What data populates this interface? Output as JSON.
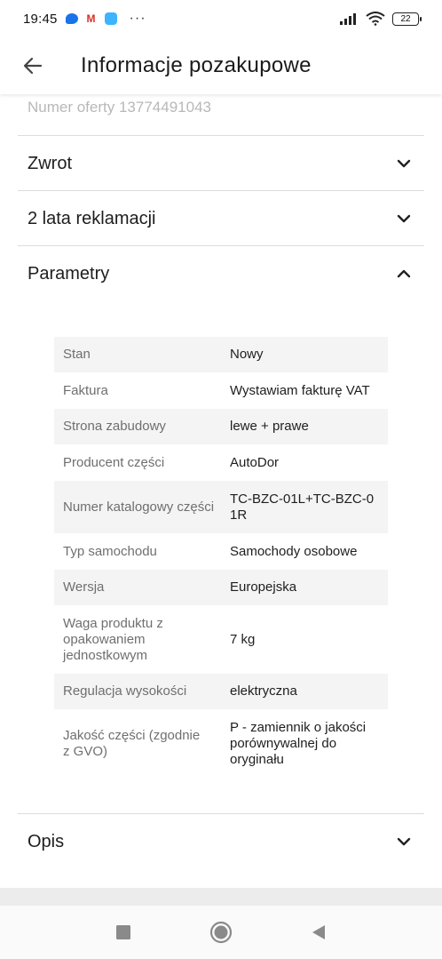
{
  "status_bar": {
    "time": "19:45",
    "mail_glyph": "M",
    "more": "···",
    "battery": "22"
  },
  "header": {
    "title": "Informacje pozakupowe",
    "back_icon": "arrow-left-icon"
  },
  "offer_number": "Numer oferty 13774491043",
  "sections": [
    {
      "label": "Zwrot",
      "expanded": false
    },
    {
      "label": "2 lata reklamacji",
      "expanded": false
    },
    {
      "label": "Parametry",
      "expanded": true
    },
    {
      "label": "Opis",
      "expanded": false
    }
  ],
  "parameters": [
    {
      "key": "Stan",
      "value": "Nowy"
    },
    {
      "key": "Faktura",
      "value": "Wystawiam fakturę VAT"
    },
    {
      "key": "Strona zabudowy",
      "value": "lewe + prawe"
    },
    {
      "key": "Producent części",
      "value": "AutoDor"
    },
    {
      "key": "Numer katalogowy części",
      "value": "TC-BZC-01L+TC-BZC-01R"
    },
    {
      "key": "Typ samochodu",
      "value": "Samochody osobowe"
    },
    {
      "key": "Wersja",
      "value": "Europejska"
    },
    {
      "key": "Waga produktu z opakowaniem jednostkowym",
      "value": "7 kg"
    },
    {
      "key": "Regulacja wysokości",
      "value": "elektryczna"
    },
    {
      "key": "Jakość części (zgodnie z GVO)",
      "value": "P - zamiennik o jakości porównywalnej do oryginału"
    }
  ],
  "colors": {
    "row_shade": "#f4f4f4",
    "key_text": "#6f6f6f",
    "divider": "#dcdcdc"
  }
}
